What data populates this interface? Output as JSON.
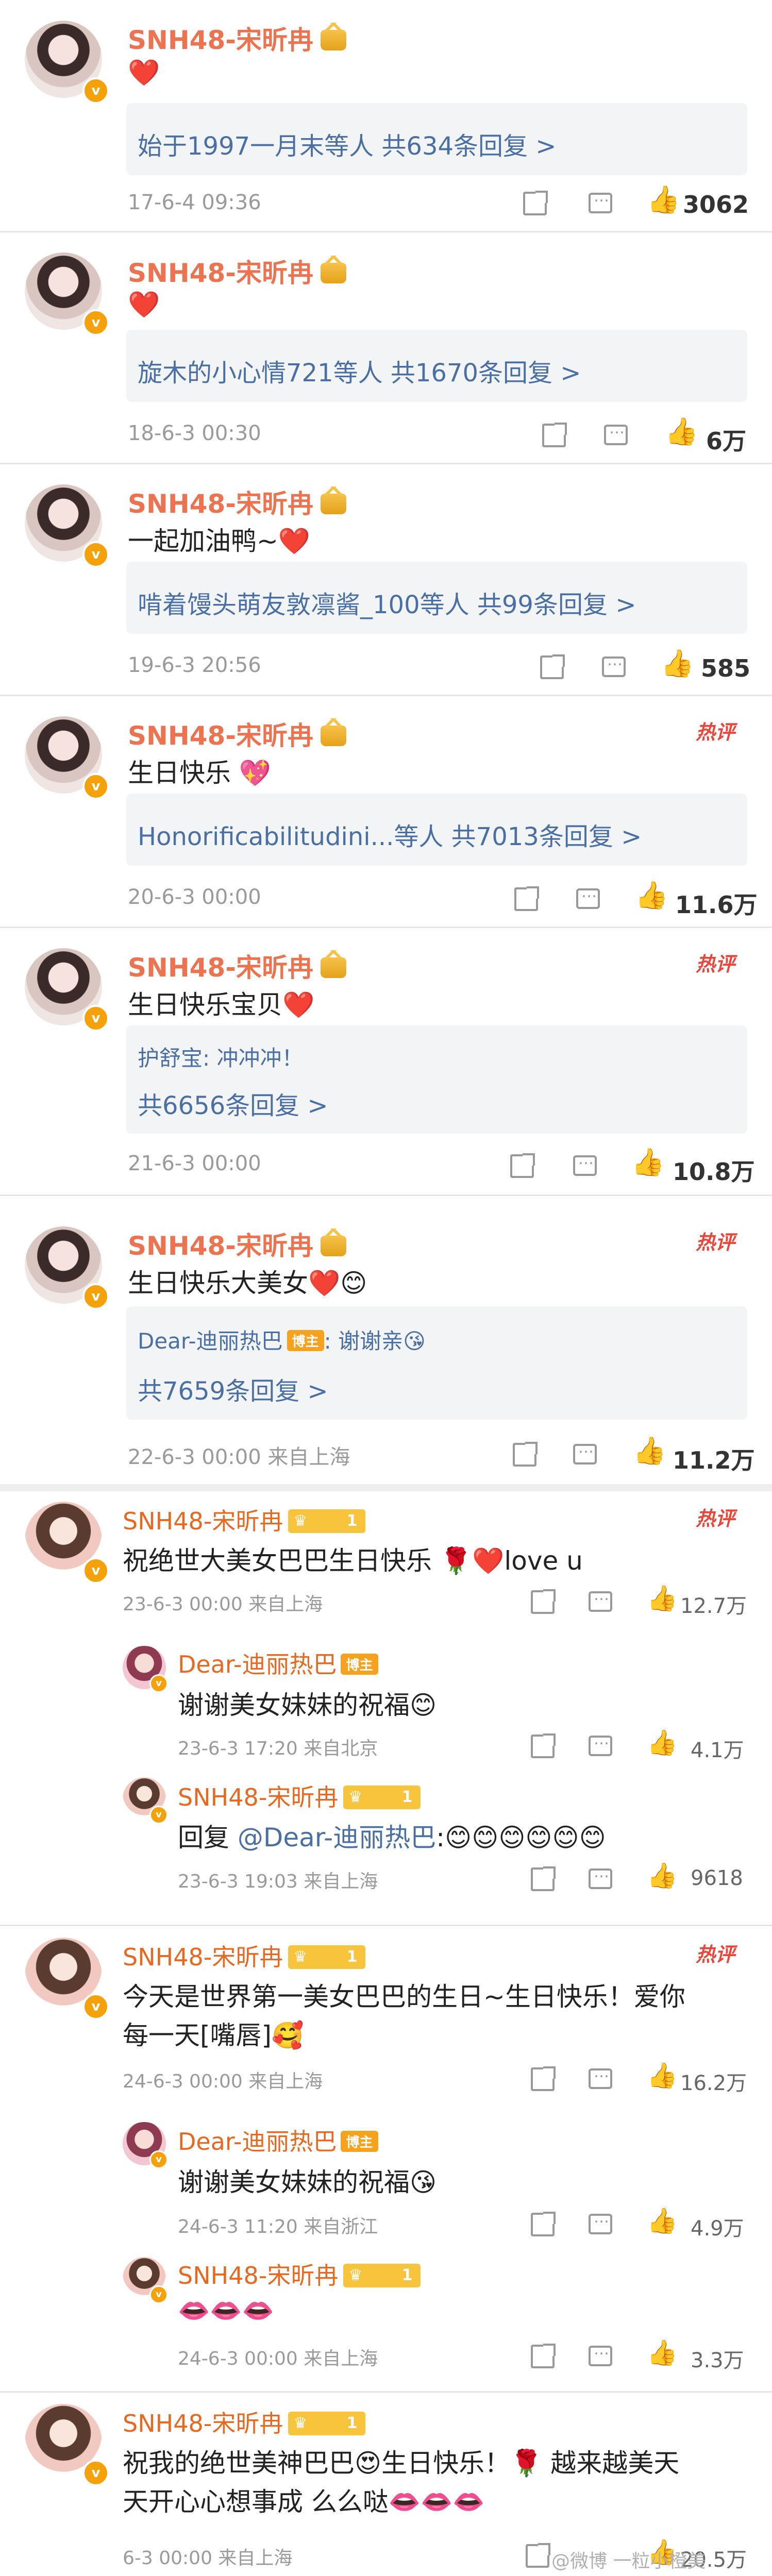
{
  "comments": [
    {
      "user": "SNH48-宋昕冉",
      "text": "❤️",
      "reply_summary": "始于1997一月末等人  共634条回复 >",
      "time": "17-6-4 09:36",
      "likes": "3062"
    },
    {
      "user": "SNH48-宋昕冉",
      "text": "❤️",
      "reply_summary": "旋木的小心情721等人  共1670条回复 >",
      "time": "18-6-3 00:30",
      "likes": "6万"
    },
    {
      "user": "SNH48-宋昕冉",
      "text": "一起加油鸭~❤️",
      "reply_summary": "啃着馒头萌友敦凛酱_100等人  共99条回复 >",
      "time": "19-6-3 20:56",
      "likes": "585"
    },
    {
      "user": "SNH48-宋昕冉",
      "text": "生日快乐 💖",
      "reply_summary": "Honorificabilitudini...等人  共7013条回复 >",
      "time": "20-6-3 00:00",
      "likes": "11.6万",
      "hot": "热评"
    },
    {
      "user": "SNH48-宋昕冉",
      "text": "生日快乐宝贝❤️",
      "quote_line": "护舒宝: 冲冲冲！",
      "reply_summary": "共6656条回复 >",
      "time": "21-6-3 00:00",
      "likes": "10.8万",
      "hot": "热评"
    },
    {
      "user": "SNH48-宋昕冉",
      "text": "生日快乐大美女❤️😊",
      "quote_user": "Dear-迪丽热巴",
      "quote_badge": "博主",
      "quote_text": ": 谢谢亲😘",
      "reply_summary": "共7659条回复 >",
      "time": "22-6-3 00:00  来自上海",
      "likes": "11.2万",
      "hot": "热评"
    }
  ],
  "thread1": {
    "user": "SNH48-宋昕冉",
    "level": "1",
    "text": "祝绝世大美女巴巴生日快乐 🌹❤️love u",
    "time": "23-6-3 00:00  来自上海",
    "likes": "12.7万",
    "hot": "热评",
    "replies": [
      {
        "user": "Dear-迪丽热巴",
        "badge": "博主",
        "text": "谢谢美女妹妹的祝福😊",
        "time": "23-6-3 17:20  来自北京",
        "likes": "4.1万"
      },
      {
        "user": "SNH48-宋昕冉",
        "level": "1",
        "text_prefix": "回复 ",
        "mention": "@Dear-迪丽热巴",
        "text_suffix": ":😊😊😊😊😊😊",
        "time": "23-6-3 19:03  来自上海",
        "likes": "9618"
      }
    ]
  },
  "thread2": {
    "user": "SNH48-宋昕冉",
    "level": "1",
    "text_line1": "今天是世界第一美女巴巴的生日~生日快乐！爱你",
    "text_line2": "每一天[嘴唇]🥰",
    "time": "24-6-3 00:00  来自上海",
    "likes": "16.2万",
    "hot": "热评",
    "replies": [
      {
        "user": "Dear-迪丽热巴",
        "badge": "博主",
        "text": "谢谢美女妹妹的祝福😘",
        "time": "24-6-3 11:20  来自浙江",
        "likes": "4.9万"
      },
      {
        "user": "SNH48-宋昕冉",
        "level": "1",
        "text": "👄👄👄",
        "time": "24-6-3 00:00  来自上海",
        "likes": "3.3万"
      }
    ]
  },
  "thread3": {
    "user": "SNH48-宋昕冉",
    "level": "1",
    "text_line1": "祝我的绝世美神巴巴😍生日快乐！🌹 越来越美天",
    "text_line2": "天开心心想事成 么么哒👄👄👄",
    "time": "6-3 00:00  来自上海",
    "likes": "20.5万"
  },
  "watermark": "@微博 一粒小橙美"
}
